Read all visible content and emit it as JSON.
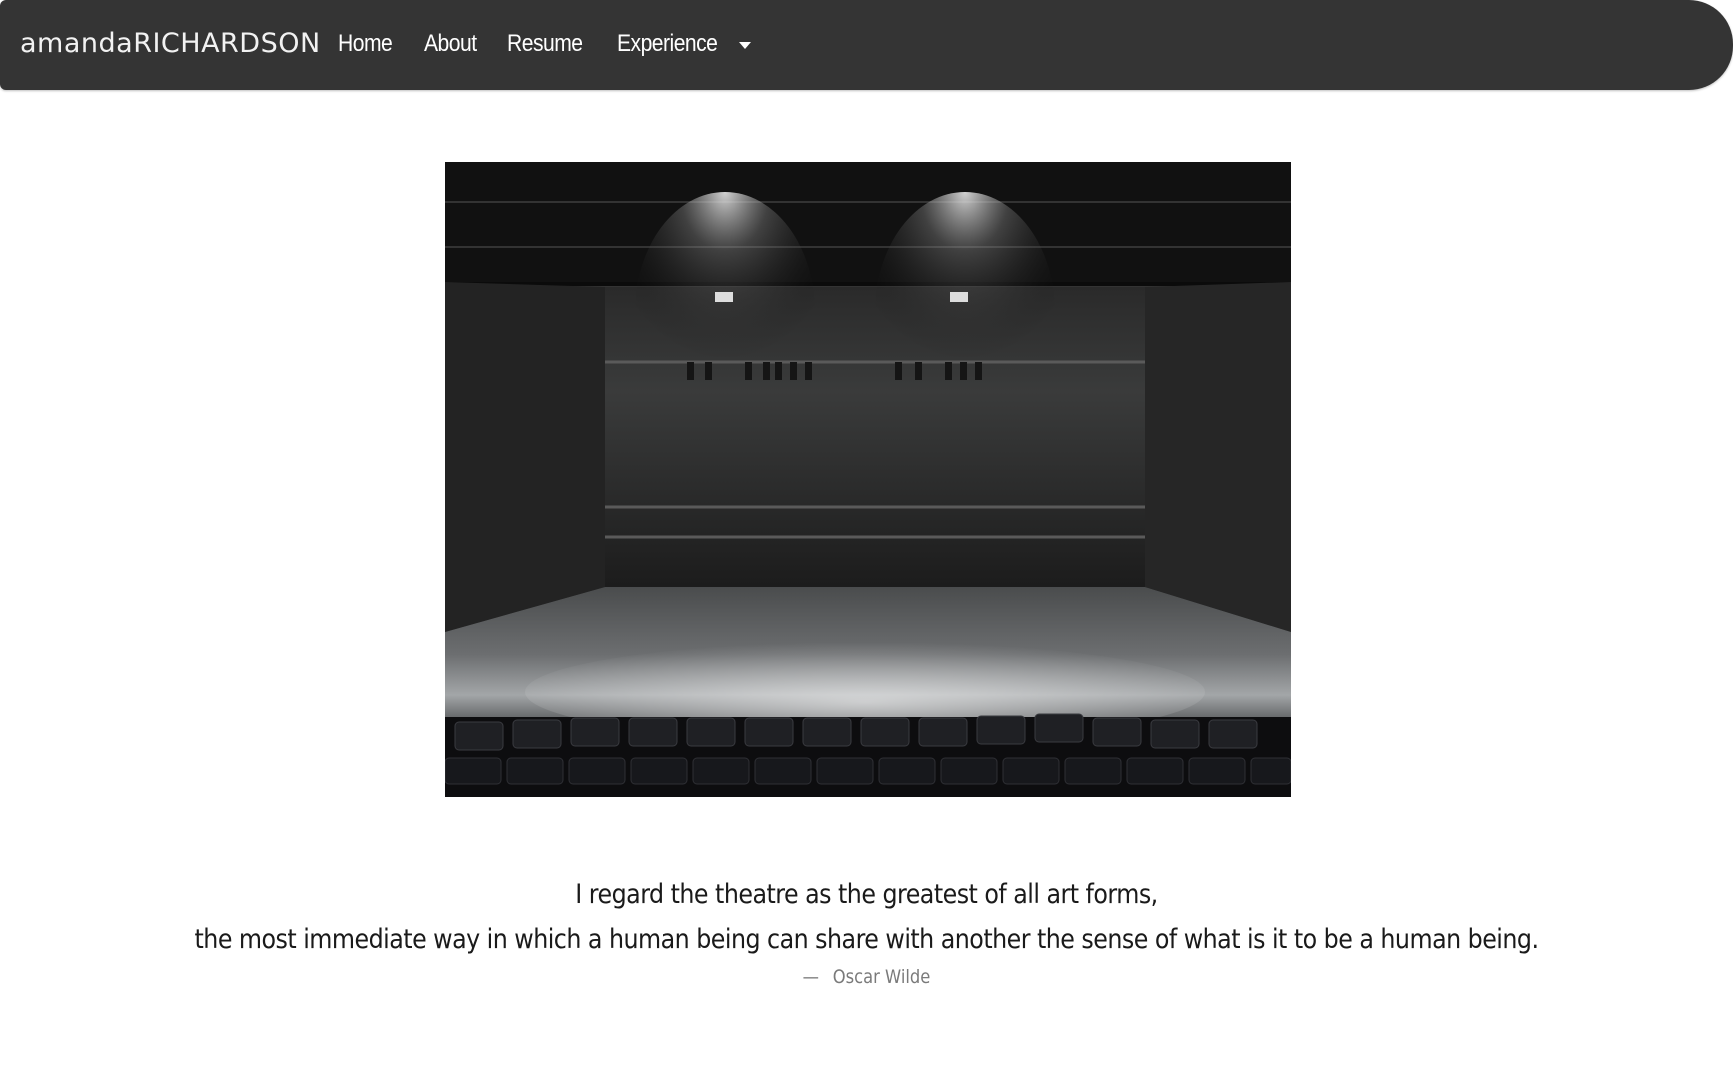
{
  "navbar": {
    "brand": "amandaRICHARDSON",
    "links": [
      {
        "label": "Home"
      },
      {
        "label": "About"
      },
      {
        "label": "Resume"
      }
    ],
    "dropdown": {
      "label": "Experience",
      "icon": "caret-down-icon"
    },
    "background_color": "#343434",
    "text_color": "#ffffff"
  },
  "hero": {
    "subject": "empty black-box theatre stage with seating"
  },
  "quote": {
    "line1": "I regard the theatre as the greatest of all art forms,",
    "line2": "the most immediate way in which a human being can share with another the sense of what is it to be a human being.",
    "dash": "—",
    "author": "Oscar Wilde"
  }
}
